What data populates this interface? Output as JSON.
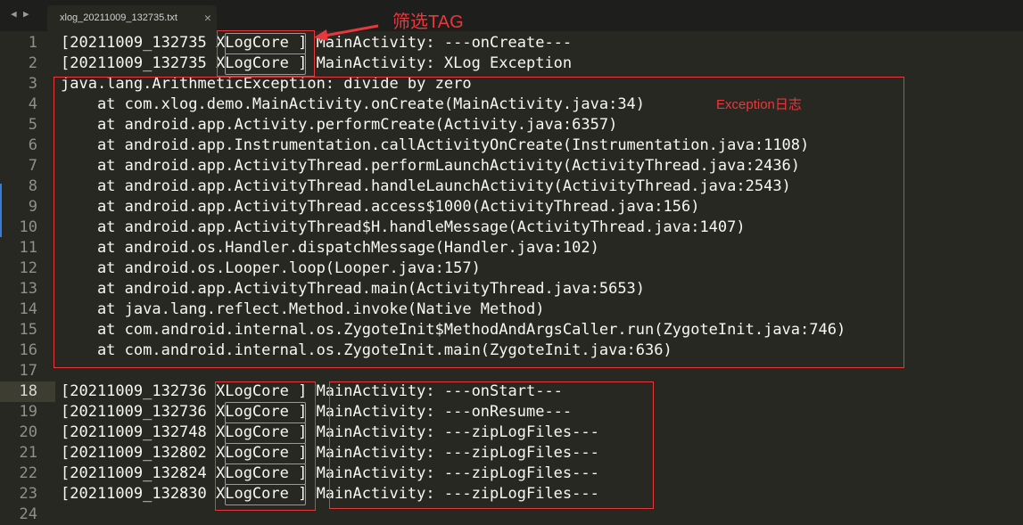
{
  "tabbar": {
    "nav_left": "◀",
    "nav_right": "▶",
    "tab_title": "xlog_20211009_132735.txt",
    "close": "✕"
  },
  "gutter": [
    "1",
    "2",
    "3",
    "4",
    "5",
    "6",
    "7",
    "8",
    "9",
    "10",
    "11",
    "12",
    "13",
    "14",
    "15",
    "16",
    "17",
    "18",
    "19",
    "20",
    "21",
    "22",
    "23",
    "24"
  ],
  "active_line": "18",
  "lines": [
    "[20211009_132735 XLogCore ] MainActivity: ---onCreate---",
    "[20211009_132735 XLogCore ] MainActivity: XLog Exception",
    "java.lang.ArithmeticException: divide by zero",
    "    at com.xlog.demo.MainActivity.onCreate(MainActivity.java:34)",
    "    at android.app.Activity.performCreate(Activity.java:6357)",
    "    at android.app.Instrumentation.callActivityOnCreate(Instrumentation.java:1108)",
    "    at android.app.ActivityThread.performLaunchActivity(ActivityThread.java:2436)",
    "    at android.app.ActivityThread.handleLaunchActivity(ActivityThread.java:2543)",
    "    at android.app.ActivityThread.access$1000(ActivityThread.java:156)",
    "    at android.app.ActivityThread$H.handleMessage(ActivityThread.java:1407)",
    "    at android.os.Handler.dispatchMessage(Handler.java:102)",
    "    at android.os.Looper.loop(Looper.java:157)",
    "    at android.app.ActivityThread.main(ActivityThread.java:5653)",
    "    at java.lang.reflect.Method.invoke(Native Method)",
    "    at com.android.internal.os.ZygoteInit$MethodAndArgsCaller.run(ZygoteInit.java:746)",
    "    at com.android.internal.os.ZygoteInit.main(ZygoteInit.java:636)",
    "",
    "[20211009_132736 XLogCore ] MainActivity: ---onStart---",
    "[20211009_132736 XLogCore ] MainActivity: ---onResume---",
    "[20211009_132748 XLogCore ] MainActivity: ---zipLogFiles---",
    "[20211009_132802 XLogCore ] MainActivity: ---zipLogFiles---",
    "[20211009_132824 XLogCore ] MainActivity: ---zipLogFiles---",
    "[20211009_132830 XLogCore ] MainActivity: ---zipLogFiles---",
    ""
  ],
  "annotations": {
    "filter_tag": "筛选TAG",
    "exception_log": "Exception日志"
  },
  "colors": {
    "annotation_red": "#e8383c",
    "editor_bg": "#272822",
    "text": "#f8f8f2",
    "gutter_text": "#8f908a"
  }
}
